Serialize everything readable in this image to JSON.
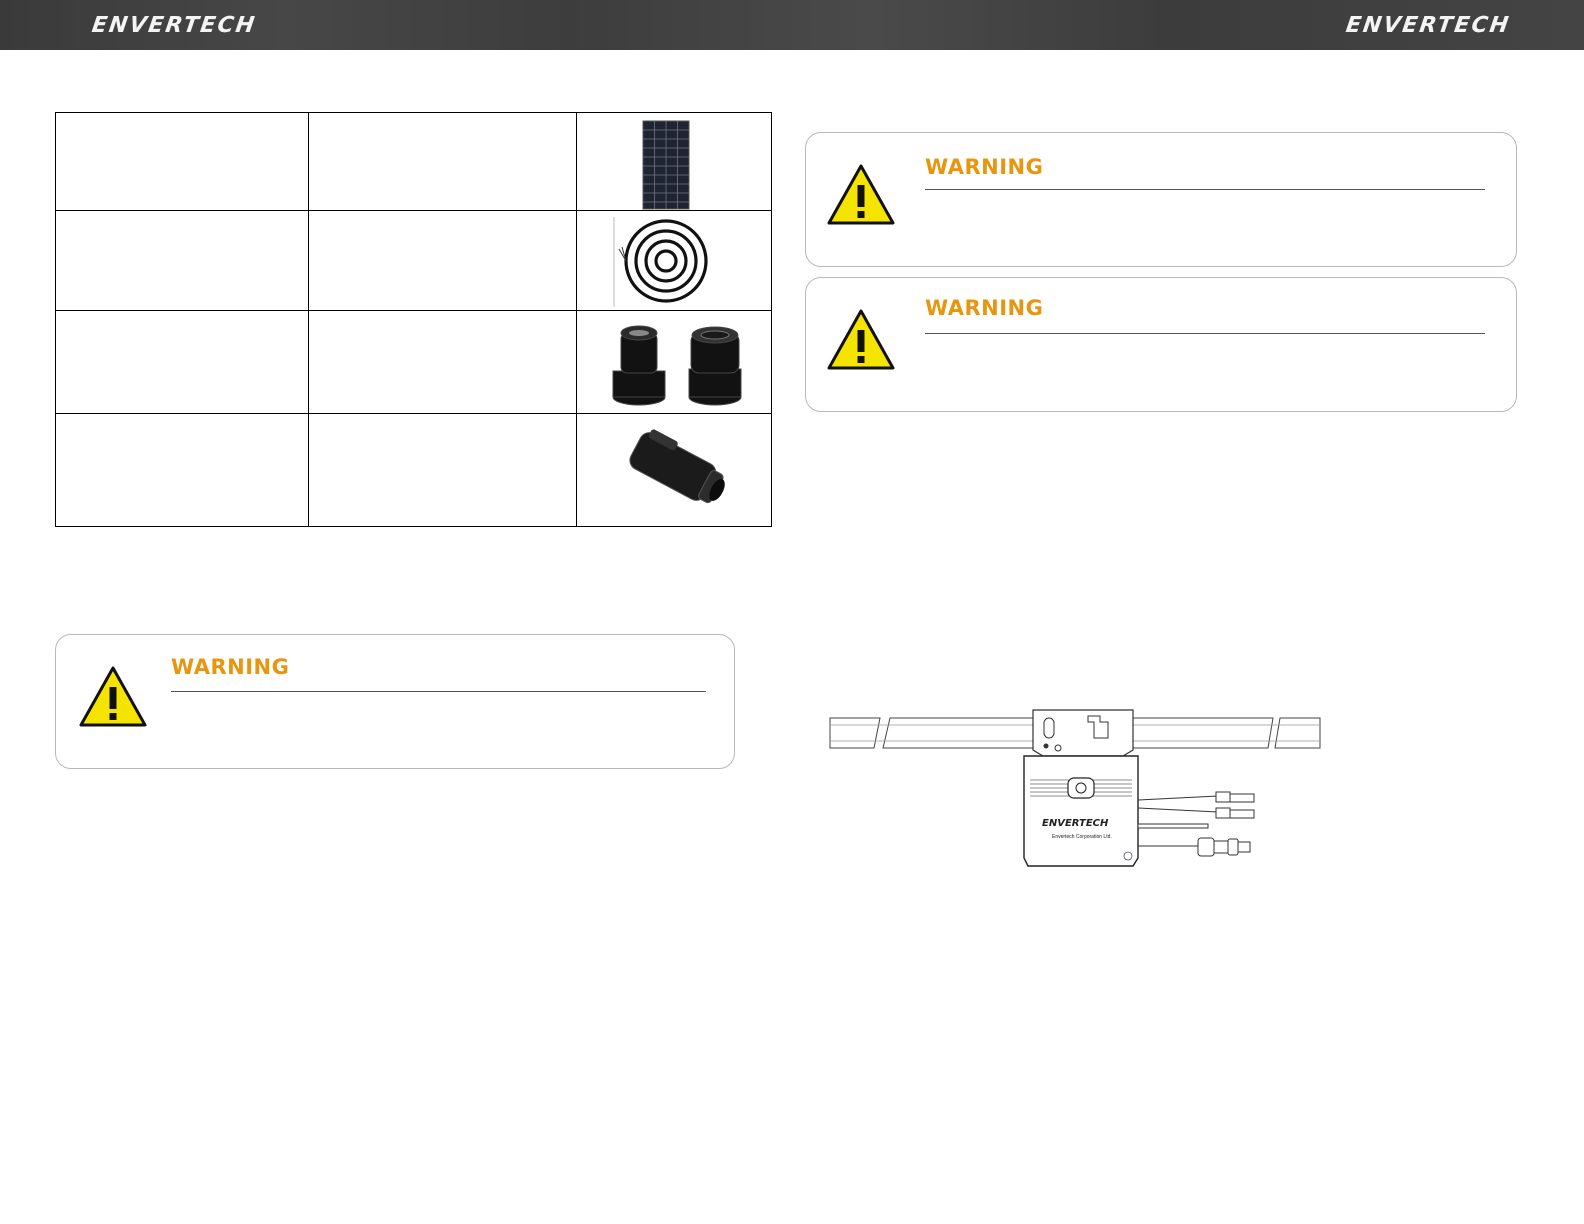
{
  "header": {
    "brand_left": "ENVERTECH",
    "brand_right": "ENVERTECH",
    "bar_color": "#404040"
  },
  "accessories_table": {
    "rows": [
      {
        "name": "",
        "description": "",
        "image": "solar-panel-image"
      },
      {
        "name": "",
        "description": "",
        "image": "coiled-cable-image"
      },
      {
        "name": "",
        "description": "",
        "image": "connector-caps-image"
      },
      {
        "name": "",
        "description": "",
        "image": "connector-plug-image"
      }
    ]
  },
  "warnings": [
    {
      "title": "WARNING",
      "body": ""
    },
    {
      "title": "WARNING",
      "body": ""
    },
    {
      "title": "WARNING",
      "body": ""
    }
  ],
  "inverter_figure": {
    "brand_label": "ENVERTECH",
    "company_label": "Envertech Corporation Ltd.",
    "image": "microinverter-on-rail-drawing"
  },
  "colors": {
    "warning_title": "#e8960f",
    "warning_icon_fill": "#f5e400"
  }
}
